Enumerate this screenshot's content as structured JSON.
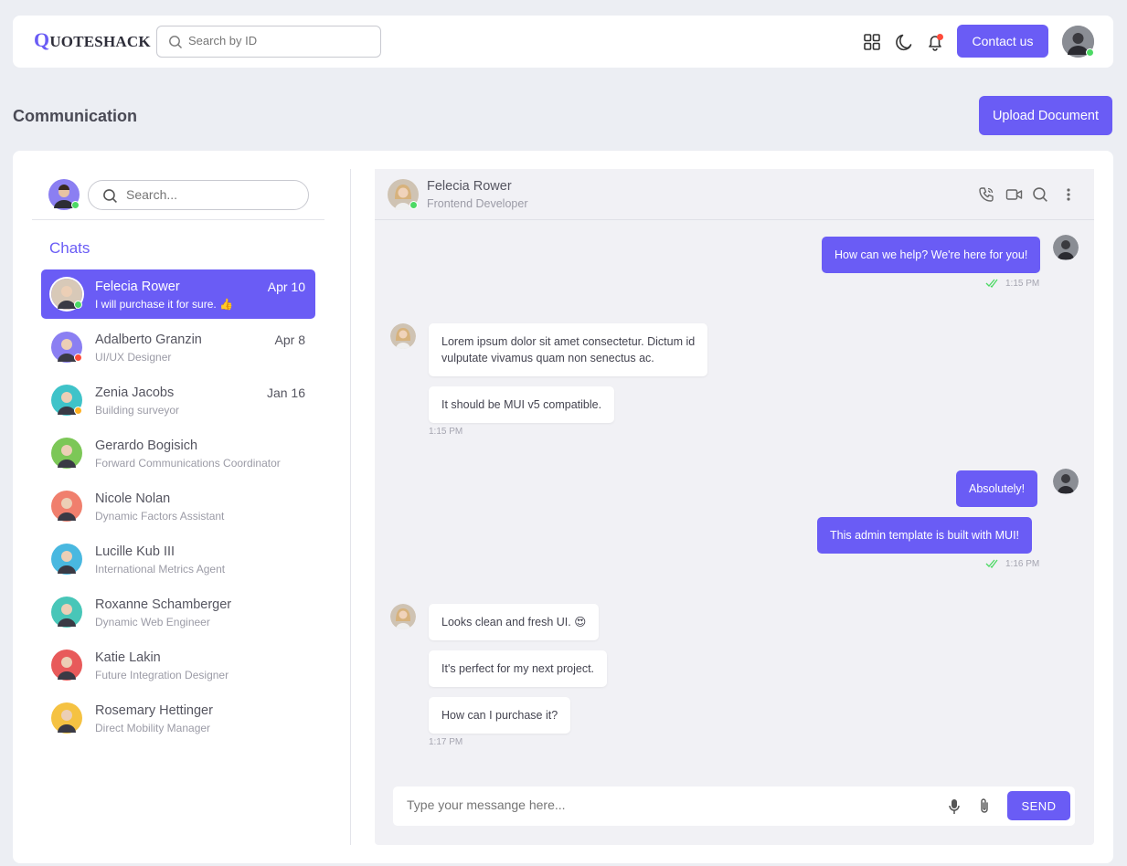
{
  "topbar": {
    "logo_first": "Q",
    "logo_rest": "UOTESHACK",
    "search_placeholder": "Search by ID",
    "contact_label": "Contact us"
  },
  "page": {
    "title": "Communication",
    "upload_label": "Upload Document"
  },
  "sidebar": {
    "search_placeholder": "Search...",
    "chats_title": "Chats",
    "chats": [
      {
        "name": "Felecia Rower",
        "sub": "I will purchase it for sure. 👍",
        "date": "Apr 10",
        "avatar_color": "#d8c9b8",
        "status": "#4cd964",
        "active": true
      },
      {
        "name": "Adalberto Granzin",
        "sub": "UI/UX Designer",
        "date": "Apr 8",
        "avatar_color": "#8b7ff2",
        "status": "#ff4a3a"
      },
      {
        "name": "Zenia Jacobs",
        "sub": "Building surveyor",
        "date": "Jan 16",
        "avatar_color": "#3fc3c9",
        "status": "#ffb020"
      },
      {
        "name": "Gerardo Bogisich",
        "sub": "Forward Communications Coordinator",
        "date": "",
        "avatar_color": "#7cc757",
        "status": ""
      },
      {
        "name": "Nicole Nolan",
        "sub": "Dynamic Factors Assistant",
        "date": "",
        "avatar_color": "#f07f6d",
        "status": ""
      },
      {
        "name": "Lucille Kub III",
        "sub": "International Metrics Agent",
        "date": "",
        "avatar_color": "#49b8e0",
        "status": ""
      },
      {
        "name": "Roxanne Schamberger",
        "sub": "Dynamic Web Engineer",
        "date": "",
        "avatar_color": "#48c6b8",
        "status": ""
      },
      {
        "name": "Katie Lakin",
        "sub": "Future Integration Designer",
        "date": "",
        "avatar_color": "#e85a5a",
        "status": ""
      },
      {
        "name": "Rosemary Hettinger",
        "sub": "Direct Mobility Manager",
        "date": "",
        "avatar_color": "#f5c242",
        "status": ""
      }
    ]
  },
  "conversation": {
    "contact_name": "Felecia Rower",
    "contact_role": "Frontend Developer",
    "messages": {
      "m1": "How can we help? We're here for you!",
      "t1": "1:15 PM",
      "m2a": "Lorem ipsum dolor sit amet consectetur. Dictum id",
      "m2b": "vulputate vivamus quam non senectus ac.",
      "m3": "It should be MUI v5 compatible.",
      "t2": "1:15 PM",
      "m4": "Absolutely!",
      "m5": "This admin template is built with MUI!",
      "t3": "1:16 PM",
      "m6": "Looks clean and fresh UI. 😍",
      "m7": "It's perfect for my next project.",
      "m8": "How can I purchase it?",
      "t4": "1:17 PM"
    },
    "composer_placeholder": "Type your messange here...",
    "send_label": "SEND"
  },
  "colors": {
    "accent": "#6a5cf5",
    "online": "#4cd964",
    "busy": "#ff4a3a",
    "away": "#ffb020"
  }
}
